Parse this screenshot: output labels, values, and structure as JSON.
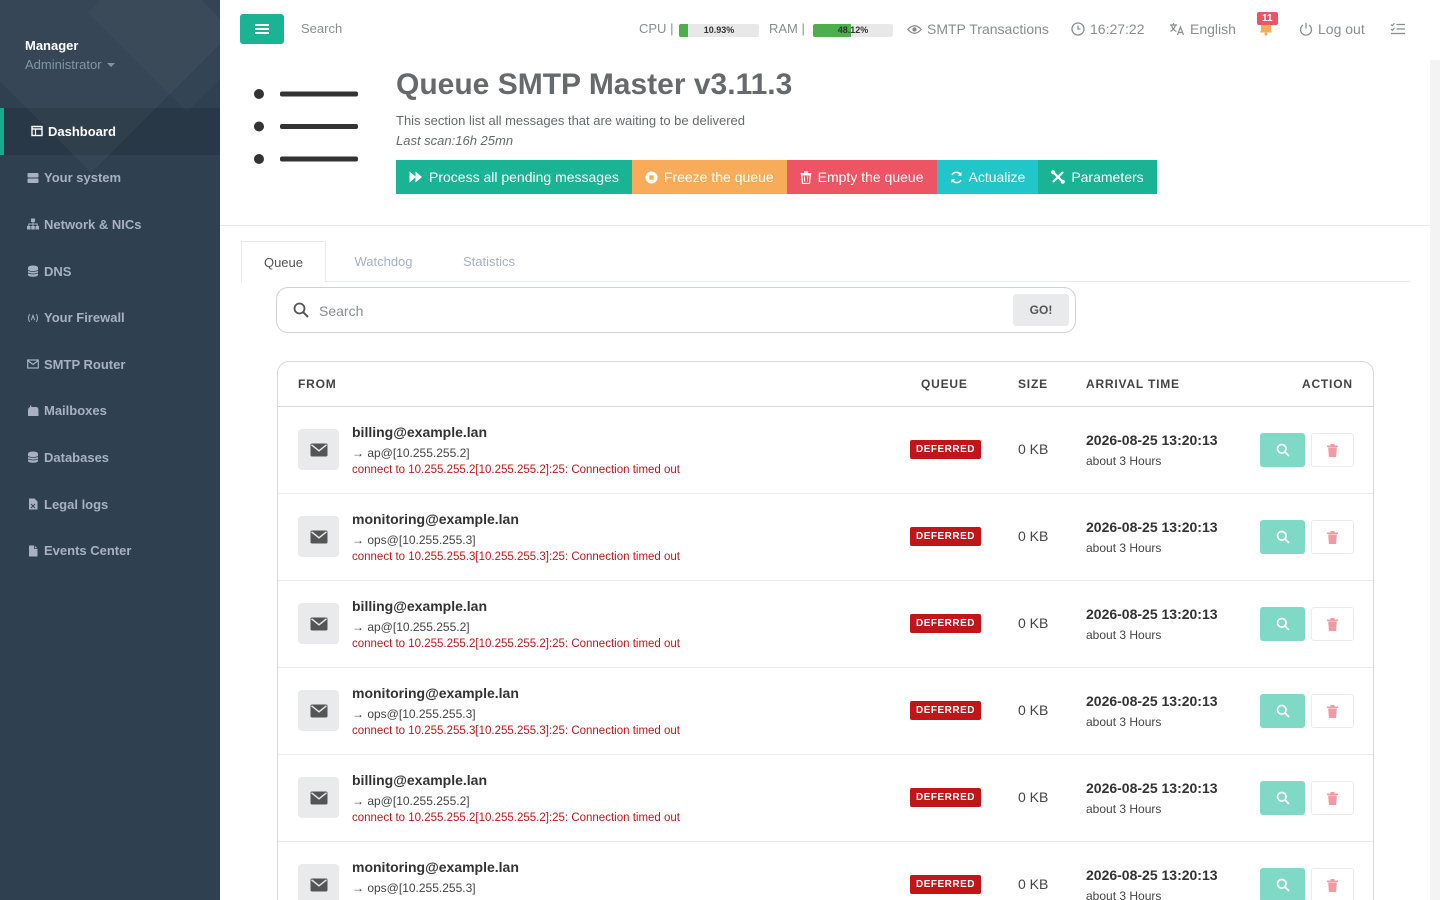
{
  "sidebar": {
    "profile": {
      "name": "Manager",
      "role": "Administrator"
    },
    "items": [
      {
        "label": "Dashboard",
        "icon": "dashboard-icon",
        "active": true
      },
      {
        "label": "Your system",
        "icon": "server-icon"
      },
      {
        "label": "Network & NICs",
        "icon": "sitemap-icon"
      },
      {
        "label": "DNS",
        "icon": "database-icon"
      },
      {
        "label": "Your Firewall",
        "icon": "firewall-icon"
      },
      {
        "label": "SMTP Router",
        "icon": "envelope-icon"
      },
      {
        "label": "Mailboxes",
        "icon": "mailbox-icon"
      },
      {
        "label": "Databases",
        "icon": "database-icon"
      },
      {
        "label": "Legal logs",
        "icon": "file-legal-icon"
      },
      {
        "label": "Events Center",
        "icon": "file-icon"
      }
    ]
  },
  "topbar": {
    "search_placeholder": "Search",
    "cpu": {
      "label": "CPU",
      "value_text": "10.93%",
      "fraction": 0.1093
    },
    "ram": {
      "label": "RAM",
      "value_text": "48.12%",
      "fraction": 0.4812
    },
    "smtp_transactions": "SMTP Transactions",
    "time": "16:27:22",
    "language": "English",
    "notifications": "11",
    "logout": "Log out"
  },
  "header": {
    "title": "Queue SMTP Master v3.11.3",
    "description": "This section list all messages that are waiting to be delivered",
    "last_scan": "Last scan:16h 25mn",
    "actions": [
      {
        "label": "Process all pending messages",
        "color": "#1ab394",
        "icon": "fast-forward-icon"
      },
      {
        "label": "Freeze the queue",
        "color": "#f8ac59",
        "icon": "stop-circle-icon"
      },
      {
        "label": "Empty the queue",
        "color": "#ed5565",
        "icon": "trash-icon"
      },
      {
        "label": "Actualize",
        "color": "#23c6c8",
        "icon": "refresh-icon"
      },
      {
        "label": "Parameters",
        "color": "#1ab394",
        "icon": "tools-icon"
      }
    ]
  },
  "tabs": [
    {
      "label": "Queue",
      "active": true
    },
    {
      "label": "Watchdog"
    },
    {
      "label": "Statistics"
    }
  ],
  "search": {
    "placeholder": "Search",
    "go_label": "GO!"
  },
  "table": {
    "columns": [
      "FROM",
      "QUEUE",
      "SIZE",
      "ARRIVAL TIME",
      "ACTION"
    ],
    "rows": [
      {
        "from": "billing@example.lan",
        "to": "→ ap@[10.255.255.2]",
        "error": "connect to 10.255.255.2[10.255.255.2]:25: Connection timed out",
        "queue": "DEFERRED",
        "size": "0 KB",
        "arrival": "2026-08-25 13:20:13",
        "ago": "about 3 Hours"
      },
      {
        "from": "monitoring@example.lan",
        "to": "→ ops@[10.255.255.3]",
        "error": "connect to 10.255.255.3[10.255.255.3]:25: Connection timed out",
        "queue": "DEFERRED",
        "size": "0 KB",
        "arrival": "2026-08-25 13:20:13",
        "ago": "about 3 Hours"
      },
      {
        "from": "billing@example.lan",
        "to": "→ ap@[10.255.255.2]",
        "error": "connect to 10.255.255.2[10.255.255.2]:25: Connection timed out",
        "queue": "DEFERRED",
        "size": "0 KB",
        "arrival": "2026-08-25 13:20:13",
        "ago": "about 3 Hours"
      },
      {
        "from": "monitoring@example.lan",
        "to": "→ ops@[10.255.255.3]",
        "error": "connect to 10.255.255.3[10.255.255.3]:25: Connection timed out",
        "queue": "DEFERRED",
        "size": "0 KB",
        "arrival": "2026-08-25 13:20:13",
        "ago": "about 3 Hours"
      },
      {
        "from": "billing@example.lan",
        "to": "→ ap@[10.255.255.2]",
        "error": "connect to 10.255.255.2[10.255.255.2]:25: Connection timed out",
        "queue": "DEFERRED",
        "size": "0 KB",
        "arrival": "2026-08-25 13:20:13",
        "ago": "about 3 Hours"
      },
      {
        "from": "monitoring@example.lan",
        "to": "→ ops@[10.255.255.3]",
        "error": "",
        "queue": "DEFERRED",
        "size": "0 KB",
        "arrival": "2026-08-25 13:20:13",
        "ago": "about 3 Hours"
      }
    ]
  }
}
